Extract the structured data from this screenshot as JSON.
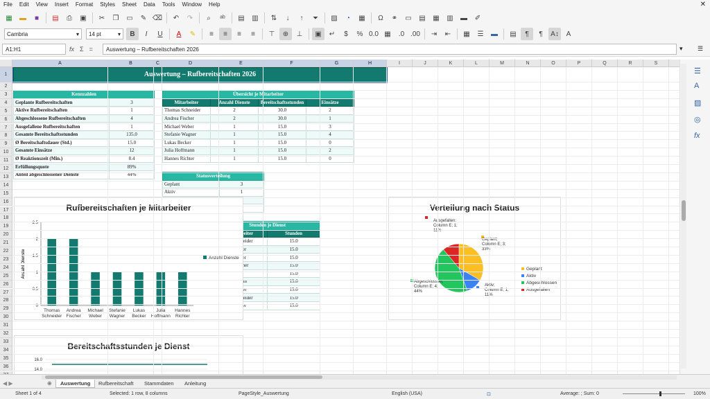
{
  "menu": [
    "File",
    "Edit",
    "View",
    "Insert",
    "Format",
    "Styles",
    "Sheet",
    "Data",
    "Tools",
    "Window",
    "Help"
  ],
  "toolbar": {
    "font_name": "Cambria",
    "font_size": "14 pt"
  },
  "formula_bar": {
    "name_box": "A1:H1",
    "content": "Auswertung – Rufbereitschaften 2026",
    "fx": "fx",
    "sigma": "Σ",
    "eq": "="
  },
  "columns": [
    {
      "l": "A",
      "w": 138,
      "s": true
    },
    {
      "l": "B",
      "w": 66,
      "s": true
    },
    {
      "l": "C",
      "w": 12,
      "s": true
    },
    {
      "l": "D",
      "w": 82,
      "s": true
    },
    {
      "l": "E",
      "w": 64,
      "s": true
    },
    {
      "l": "F",
      "w": 82,
      "s": true
    },
    {
      "l": "G",
      "w": 48,
      "s": true
    },
    {
      "l": "H",
      "w": 48,
      "s": true
    },
    {
      "l": "I",
      "w": 37
    },
    {
      "l": "J",
      "w": 37
    },
    {
      "l": "K",
      "w": 37
    },
    {
      "l": "L",
      "w": 37
    },
    {
      "l": "M",
      "w": 37
    },
    {
      "l": "N",
      "w": 37
    },
    {
      "l": "O",
      "w": 37
    },
    {
      "l": "P",
      "w": 37
    },
    {
      "l": "Q",
      "w": 37
    },
    {
      "l": "R",
      "w": 37
    },
    {
      "l": "S",
      "w": 37
    },
    {
      "l": "T",
      "w": 37
    }
  ],
  "rows": [
    "1",
    "2",
    "3",
    "4",
    "5",
    "6",
    "7",
    "8",
    "9",
    "10",
    "11",
    "12",
    "13",
    "14",
    "15",
    "16",
    "17",
    "18",
    "19",
    "20",
    "21",
    "22",
    "23",
    "24",
    "25",
    "26",
    "27",
    "28",
    "29",
    "30",
    "31",
    "32",
    "33",
    "34",
    "35",
    "36",
    "37"
  ],
  "title": "Auswertung – Rufbereitschaften 2026",
  "kennzahlen": {
    "caption": "Kennzahlen",
    "rows": [
      [
        "Geplante Rufbereitschaften",
        "3"
      ],
      [
        "Aktive Rufbereitschaften",
        "1"
      ],
      [
        "Abgeschlossene Rufbereitschaften",
        "4"
      ],
      [
        "Ausgefallene Rufbereitschaften",
        "1"
      ],
      [
        "Gesamte Bereitschaftsstunden",
        "135.0"
      ],
      [
        "Ø Bereitschaftsdauer (Std.)",
        "15.0"
      ],
      [
        "Gesamte Einsätze",
        "12"
      ],
      [
        "Ø Reaktionszeit (Min.)",
        "8.4"
      ],
      [
        "Erfüllungsquote",
        "89%"
      ],
      [
        "Anteil abgeschlossener Dienste",
        "44%"
      ]
    ]
  },
  "mitarbeiter": {
    "caption": "Übersicht je Mitarbeiter",
    "headers": [
      "Mitarbeiter",
      "Anzahl Dienste",
      "Bereitschaftsstunden",
      "Einsätze"
    ],
    "rows": [
      [
        "Thomas Schneider",
        "2",
        "30.0",
        "2"
      ],
      [
        "Andrea Fischer",
        "2",
        "30.0",
        "1"
      ],
      [
        "Michael Weber",
        "1",
        "15.0",
        "3"
      ],
      [
        "Stefanie Wagner",
        "1",
        "15.0",
        "4"
      ],
      [
        "Lukas Becker",
        "1",
        "15.0",
        "0"
      ],
      [
        "Julia Hoffmann",
        "1",
        "15.0",
        "2"
      ],
      [
        "Hannes Richter",
        "1",
        "15.0",
        "0"
      ]
    ]
  },
  "status": {
    "caption": "Statusverteilung",
    "rows": [
      [
        "Geplant",
        "3"
      ],
      [
        "Aktiv",
        "1"
      ],
      [
        "",
        ""
      ],
      [
        "",
        ""
      ]
    ]
  },
  "stunden": {
    "caption": "Stunden je Dienst",
    "headers": [
      "Mitarbeiter",
      "Stunden"
    ],
    "rows": [
      [
        "Thomas Schneider",
        "15.0"
      ],
      [
        "Andrea Fischer",
        "15.0"
      ],
      [
        "Michael Weber",
        "15.0"
      ],
      [
        "Stefanie Wagner",
        "15.0"
      ],
      [
        "Lukas Becker",
        "15.0"
      ],
      [
        "Julia Hoffmann",
        "15.0"
      ],
      [
        "Hannes Richter",
        "15.0"
      ],
      [
        "Thomas Schneider",
        "15.0"
      ],
      [
        "Andrea Fischer",
        "15.0"
      ]
    ]
  },
  "chart_data": [
    {
      "type": "bar",
      "title": "Rufbereitschaften je Mitarbeiter",
      "ylabel": "Anzahl Dienste",
      "legend": "Anzahl Dienste",
      "categories": [
        "Thomas Schneider",
        "Andrea Fischer",
        "Michael Weber",
        "Stefanie Wagner",
        "Lukas Becker",
        "Julia Hoffmann",
        "Hannes Richter"
      ],
      "values": [
        2,
        2,
        1,
        1,
        1,
        1,
        1
      ],
      "ylim": [
        0,
        2.5
      ],
      "yticks": [
        "0",
        "0.5",
        "1",
        "1.5",
        "2",
        "2.5"
      ],
      "color": "#127a6e"
    },
    {
      "type": "pie",
      "title": "Verteilung nach Status",
      "slices": [
        {
          "name": "Geplant",
          "value": 3,
          "color": "#fbbf24",
          "label": "Geplant; Column E; 3; 33%"
        },
        {
          "name": "Aktiv",
          "value": 1,
          "color": "#3b82f6",
          "label": "Aktiv; Column E; 1; 11%"
        },
        {
          "name": "Abgeschlossen",
          "value": 4,
          "color": "#22c55e",
          "label": "Abgeschlossen; Column E; 4; 44%"
        },
        {
          "name": "Ausgefallen",
          "value": 1,
          "color": "#dc2626",
          "label": "Ausgefallen; Column E; 1; 11%"
        }
      ]
    },
    {
      "type": "line",
      "title": "Bereitschaftsstunden je Dienst",
      "yticks": [
        "16.0",
        "14.0"
      ],
      "values": [
        15,
        15,
        15,
        15,
        15,
        15,
        15,
        15,
        15
      ],
      "color": "#127a6e"
    }
  ],
  "tabs": [
    "Auswertung",
    "Rufbereitschaft",
    "Stammdaten",
    "Anleitung"
  ],
  "statusbar": {
    "sheet": "Sheet 1 of 4",
    "selection": "Selected: 1 row, 8 columns",
    "pagestyle": "PageStyle_Auswertung",
    "lang": "English (USA)",
    "sum": "Average: ; Sum: 0",
    "zoom": "100%"
  }
}
